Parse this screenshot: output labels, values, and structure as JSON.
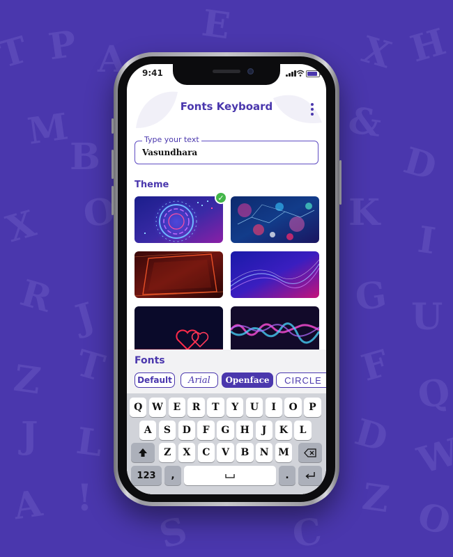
{
  "status_bar": {
    "time": "9:41"
  },
  "header": {
    "title": "Fonts Keyboard"
  },
  "text_field": {
    "label": "Type your text",
    "value": "Vasundhara"
  },
  "theme_section": {
    "title": "Theme",
    "selected_index": 0
  },
  "fonts_section": {
    "title": "Fonts",
    "options": [
      "Default",
      "Arial",
      "Openface",
      "CIRCLE"
    ],
    "selected": "Openface"
  },
  "keyboard": {
    "row1": [
      "Q",
      "W",
      "E",
      "R",
      "T",
      "Y",
      "U",
      "I",
      "O",
      "P"
    ],
    "row2": [
      "A",
      "S",
      "D",
      "F",
      "G",
      "H",
      "J",
      "K",
      "L"
    ],
    "row3": [
      "Z",
      "X",
      "C",
      "V",
      "B",
      "N",
      "M"
    ],
    "numbers_key": "123",
    "comma_key": ",",
    "period_key": "."
  },
  "colors": {
    "brand": "#4a37ad",
    "check": "#43b649",
    "keyboard_bg": "#d1d3d9"
  },
  "icons": [
    "menu-icon",
    "check-icon",
    "shift-icon",
    "backspace-icon",
    "space-icon",
    "return-icon"
  ]
}
